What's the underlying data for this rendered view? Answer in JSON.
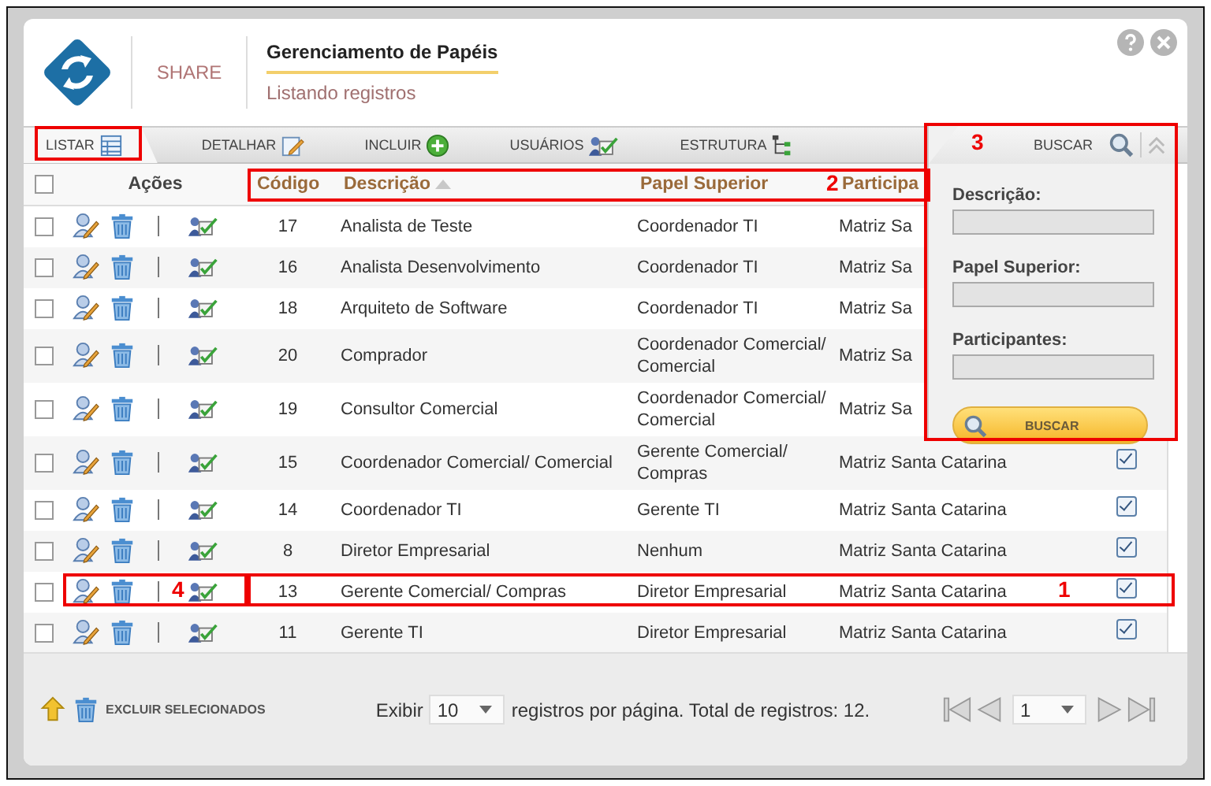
{
  "header": {
    "brand": "SHARE",
    "title": "Gerenciamento de Papéis",
    "subtitle": "Listando registros"
  },
  "tabs": [
    {
      "label": "LISTAR",
      "selected": true
    },
    {
      "label": "DETALHAR",
      "selected": false
    },
    {
      "label": "INCLUIR",
      "selected": false
    },
    {
      "label": "USUÁRIOS",
      "selected": false
    },
    {
      "label": "ESTRUTURA",
      "selected": false
    }
  ],
  "search": {
    "tab_label": "BUSCAR",
    "expanded": true,
    "fields": [
      {
        "label": "Descrição:"
      },
      {
        "label": "Papel Superior:"
      },
      {
        "label": "Participantes:"
      }
    ],
    "button": "BUSCAR"
  },
  "table": {
    "select_all": {
      "checked": false
    },
    "columns": [
      {
        "label": "Ações",
        "sorted": false
      },
      {
        "label": "Código",
        "sorted": false
      },
      {
        "label": "Descrição",
        "sorted": true
      },
      {
        "label": "Papel Superior",
        "sorted": false
      },
      {
        "label": "Participa",
        "sorted": false
      }
    ],
    "rows": [
      {
        "checked": false,
        "code": "17",
        "description": "Analista de Teste",
        "parent": "Coordenador TI",
        "participants": "Matriz Sa"
      },
      {
        "checked": false,
        "code": "16",
        "description": "Analista Desenvolvimento",
        "parent": "Coordenador TI",
        "participants": "Matriz Sa"
      },
      {
        "checked": false,
        "code": "18",
        "description": "Arquiteto de Software",
        "parent": "Coordenador TI",
        "participants": "Matriz Sa"
      },
      {
        "checked": false,
        "code": "20",
        "description": "Comprador",
        "parent": "Coordenador Comercial/ Comercial",
        "participants": "Matriz Sa"
      },
      {
        "checked": false,
        "code": "19",
        "description": "Consultor Comercial",
        "parent": "Coordenador Comercial/ Comercial",
        "participants": "Matriz Sa"
      },
      {
        "checked": false,
        "code": "15",
        "description": "Coordenador Comercial/ Comercial",
        "parent": "Gerente Comercial/ Compras",
        "participants": "Matriz Santa Catarina",
        "active": true
      },
      {
        "checked": false,
        "code": "14",
        "description": "Coordenador TI",
        "parent": "Gerente TI",
        "participants": "Matriz Santa Catarina",
        "active": true
      },
      {
        "checked": false,
        "code": "8",
        "description": "Diretor Empresarial",
        "parent": "Nenhum",
        "participants": "Matriz Santa Catarina",
        "active": true
      },
      {
        "checked": false,
        "code": "13",
        "description": "Gerente Comercial/ Compras",
        "parent": "Diretor Empresarial",
        "participants": "Matriz Santa Catarina",
        "active": true
      },
      {
        "checked": false,
        "code": "11",
        "description": "Gerente TI",
        "parent": "Diretor Empresarial",
        "participants": "Matriz Santa Catarina",
        "active": true
      }
    ]
  },
  "footer": {
    "delete_label": "EXCLUIR SELECIONADOS",
    "show_label": "Exibir",
    "page_size": "10",
    "per_page_text": "registros por página. Total de registros: 12.",
    "page": "1"
  },
  "annotations": [
    {
      "number": "3"
    },
    {
      "number": "2"
    },
    {
      "number": "4"
    },
    {
      "number": "1"
    }
  ]
}
